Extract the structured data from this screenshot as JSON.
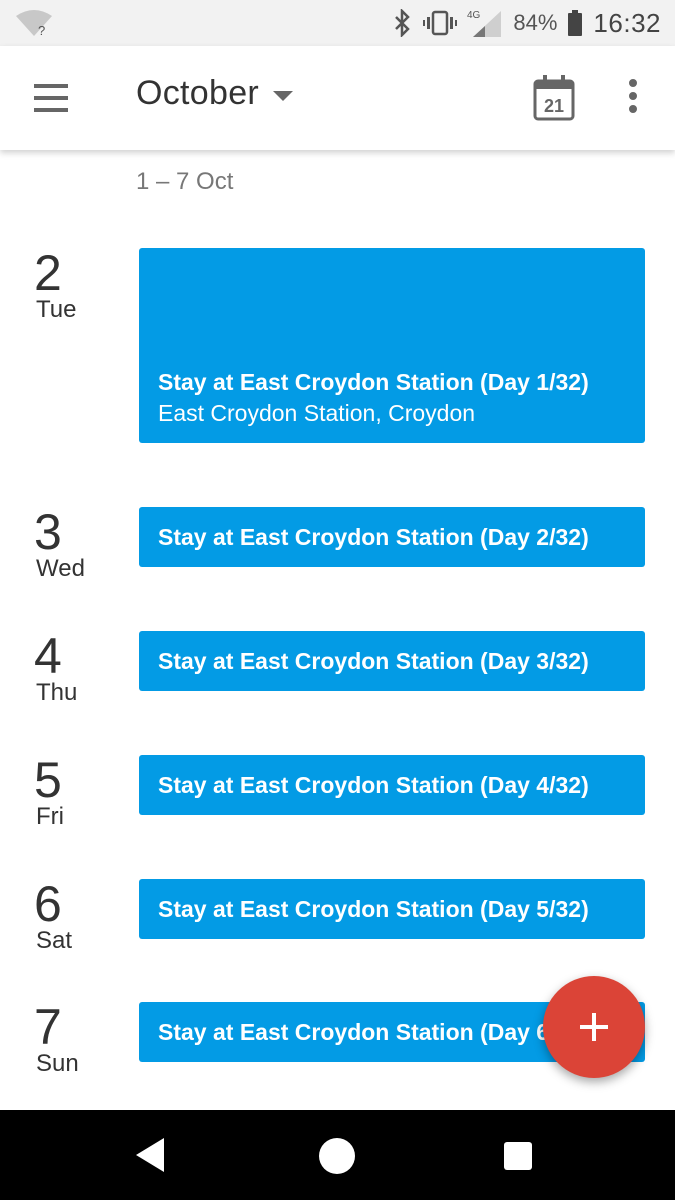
{
  "status_bar": {
    "network_type": "4G",
    "battery_percent": "84%",
    "time": "16:32",
    "wifi_badge": "?",
    "icons": [
      "wifi-unknown-icon",
      "bluetooth-icon",
      "vibrate-icon",
      "cell-signal-icon",
      "battery-icon"
    ]
  },
  "appbar": {
    "title": "October",
    "today_day": "21",
    "icons": [
      "menu-icon",
      "dropdown-caret-icon",
      "calendar-today-icon",
      "more-vert-icon"
    ]
  },
  "schedule": {
    "week_range": "1 – 7 Oct",
    "days": [
      {
        "num": "2",
        "name": "Tue",
        "event_title": "Stay at East Croydon Station (Day 1/32)",
        "event_location": "East Croydon Station, Croydon"
      },
      {
        "num": "3",
        "name": "Wed",
        "event_title": "Stay at East Croydon Station (Day 2/32)"
      },
      {
        "num": "4",
        "name": "Thu",
        "event_title": "Stay at East Croydon Station (Day 3/32)"
      },
      {
        "num": "5",
        "name": "Fri",
        "event_title": "Stay at East Croydon Station (Day 4/32)"
      },
      {
        "num": "6",
        "name": "Sat",
        "event_title": "Stay at East Croydon Station (Day 5/32)"
      },
      {
        "num": "7",
        "name": "Sun",
        "event_title": "Stay at East Croydon Station (Day 6/32)"
      }
    ]
  },
  "fab": {
    "icon": "plus-icon"
  },
  "navbar": {
    "icons": [
      "back-icon",
      "home-icon",
      "recents-icon"
    ]
  },
  "colors": {
    "event": "#039be5",
    "fab": "#db4437",
    "status_bar": "#f2f2f2",
    "nav_bar": "#000000"
  }
}
